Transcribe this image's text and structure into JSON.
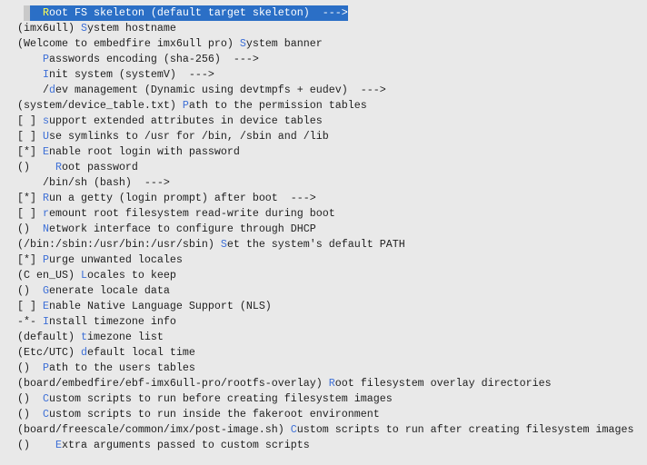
{
  "colors": {
    "background": "#e9e9e9",
    "text": "#1e1e1e",
    "hotkey": "#3d6fd6",
    "selection": "#2b6fc6",
    "selected_hotkey": "#ffff54"
  },
  "menu": {
    "selected_index": 0,
    "items": [
      {
        "pre": "    ",
        "key": "R",
        "rest": "oot FS skeleton (default target skeleton)  --->"
      },
      {
        "pre": "(imx6ull) ",
        "key": "S",
        "rest": "ystem hostname"
      },
      {
        "pre": "(Welcome to embedfire imx6ull pro) ",
        "key": "S",
        "rest": "ystem banner"
      },
      {
        "pre": "    ",
        "key": "P",
        "rest": "asswords encoding (sha-256)  --->"
      },
      {
        "pre": "    ",
        "key": "I",
        "rest": "nit system (systemV)  --->"
      },
      {
        "pre": "    /",
        "key": "d",
        "rest": "ev management (Dynamic using devtmpfs + eudev)  --->"
      },
      {
        "pre": "(system/device_table.txt) ",
        "key": "P",
        "rest": "ath to the permission tables"
      },
      {
        "pre": "[ ] ",
        "key": "s",
        "rest": "upport extended attributes in device tables"
      },
      {
        "pre": "[ ] ",
        "key": "U",
        "rest": "se symlinks to /usr for /bin, /sbin and /lib"
      },
      {
        "pre": "[*] ",
        "key": "E",
        "rest": "nable root login with password"
      },
      {
        "pre": "()    ",
        "key": "R",
        "rest": "oot password"
      },
      {
        "pre": "    /bin/sh (bash)  --->",
        "key": "",
        "rest": ""
      },
      {
        "pre": "[*] ",
        "key": "R",
        "rest": "un a getty (login prompt) after boot  --->"
      },
      {
        "pre": "[ ] ",
        "key": "r",
        "rest": "emount root filesystem read-write during boot"
      },
      {
        "pre": "()  ",
        "key": "N",
        "rest": "etwork interface to configure through DHCP"
      },
      {
        "pre": "(/bin:/sbin:/usr/bin:/usr/sbin) ",
        "key": "S",
        "rest": "et the system's default PATH"
      },
      {
        "pre": "[*] ",
        "key": "P",
        "rest": "urge unwanted locales"
      },
      {
        "pre": "(C en_US) ",
        "key": "L",
        "rest": "ocales to keep"
      },
      {
        "pre": "()  ",
        "key": "G",
        "rest": "enerate locale data"
      },
      {
        "pre": "[ ] ",
        "key": "E",
        "rest": "nable Native Language Support (NLS)"
      },
      {
        "pre": "-*- ",
        "key": "I",
        "rest": "nstall timezone info"
      },
      {
        "pre": "(default) ",
        "key": "t",
        "rest": "imezone list"
      },
      {
        "pre": "(Etc/UTC) ",
        "key": "d",
        "rest": "efault local time"
      },
      {
        "pre": "()  ",
        "key": "P",
        "rest": "ath to the users tables"
      },
      {
        "pre": "(board/embedfire/ebf-imx6ull-pro/rootfs-overlay) ",
        "key": "R",
        "rest": "oot filesystem overlay directories"
      },
      {
        "pre": "()  ",
        "key": "C",
        "rest": "ustom scripts to run before creating filesystem images"
      },
      {
        "pre": "()  ",
        "key": "C",
        "rest": "ustom scripts to run inside the fakeroot environment"
      },
      {
        "pre": "(board/freescale/common/imx/post-image.sh) ",
        "key": "C",
        "rest": "ustom scripts to run after creating filesystem images"
      },
      {
        "pre": "()    ",
        "key": "E",
        "rest": "xtra arguments passed to custom scripts"
      }
    ]
  }
}
